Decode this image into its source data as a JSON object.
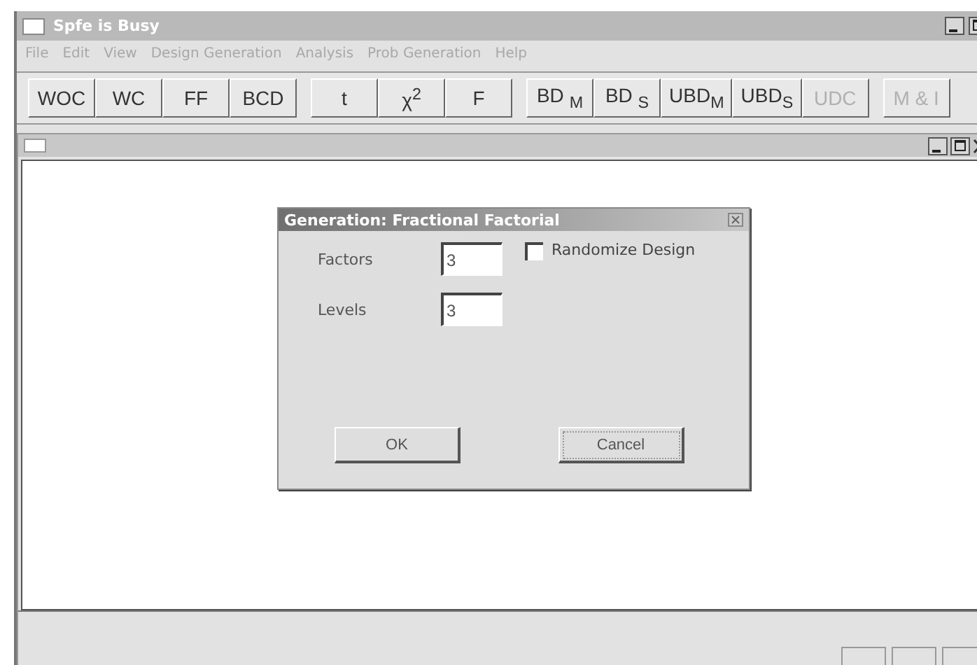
{
  "window": {
    "title": "Spfe is Busy",
    "active": false
  },
  "menu": [
    {
      "label": "File",
      "disabled": true
    },
    {
      "label": "Edit",
      "disabled": true
    },
    {
      "label": "View",
      "disabled": true
    },
    {
      "label": "Design Generation",
      "disabled": true
    },
    {
      "label": "Analysis",
      "disabled": true
    },
    {
      "label": "Prob Generation",
      "disabled": true
    },
    {
      "label": "Help",
      "disabled": true
    }
  ],
  "toolbar": [
    [
      {
        "label": "WOC",
        "disabled": false
      },
      {
        "label": "WC",
        "disabled": false
      },
      {
        "label": "FF",
        "disabled": false
      },
      {
        "label": "BCD",
        "disabled": false
      }
    ],
    [
      {
        "label": "t",
        "disabled": false
      },
      {
        "label": "χ$^{2}$",
        "disabled": false
      },
      {
        "label": "F",
        "disabled": false
      }
    ],
    [
      {
        "label": "BD $_{M}$",
        "disabled": false
      },
      {
        "label": "BD $_{S}$",
        "disabled": false
      },
      {
        "label": "UBD$_{M}$",
        "disabled": false
      },
      {
        "label": "UBD$_{S}$",
        "disabled": false
      },
      {
        "label": "UDC",
        "disabled": true
      }
    ],
    [
      {
        "label": "M & I",
        "disabled": true
      }
    ]
  ],
  "dialog": {
    "title": "Generation: Fractional Factorial",
    "fields": [
      {
        "label": "Factors",
        "value": "3"
      },
      {
        "label": "Levels",
        "value": "3"
      }
    ],
    "checkbox": {
      "label": "Randomize Design",
      "checked": false
    },
    "buttons": [
      "OK",
      "Cancel"
    ]
  }
}
